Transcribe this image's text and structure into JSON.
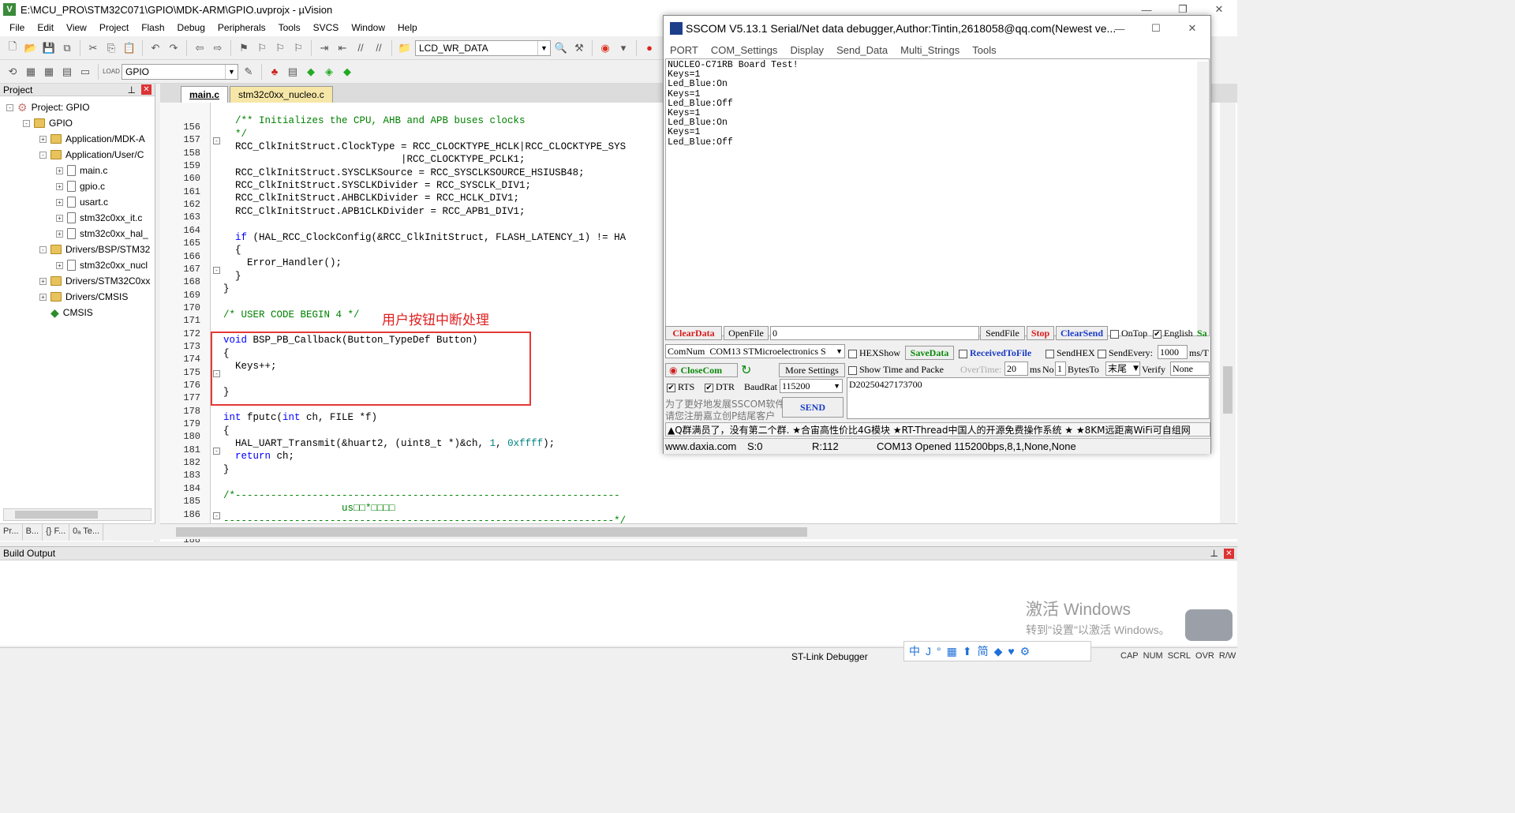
{
  "window": {
    "title": "E:\\MCU_PRO\\STM32C071\\GPIO\\MDK-ARM\\GPIO.uvprojx - µVision",
    "app_icon": "V"
  },
  "menu": [
    "File",
    "Edit",
    "View",
    "Project",
    "Flash",
    "Debug",
    "Peripherals",
    "Tools",
    "SVCS",
    "Window",
    "Help"
  ],
  "toolbar": {
    "combo1": "LCD_WR_DATA",
    "target": "GPIO"
  },
  "project": {
    "header": "Project",
    "tree": [
      {
        "label": "Project: GPIO",
        "level": 0,
        "type": "gear",
        "box": "-"
      },
      {
        "label": "GPIO",
        "level": 1,
        "type": "folder",
        "box": "-"
      },
      {
        "label": "Application/MDK-A",
        "level": 2,
        "type": "folder",
        "box": "+"
      },
      {
        "label": "Application/User/C",
        "level": 2,
        "type": "folder",
        "box": "-"
      },
      {
        "label": "main.c",
        "level": 3,
        "type": "file",
        "box": "+"
      },
      {
        "label": "gpio.c",
        "level": 3,
        "type": "file",
        "box": "+"
      },
      {
        "label": "usart.c",
        "level": 3,
        "type": "file",
        "box": "+"
      },
      {
        "label": "stm32c0xx_it.c",
        "level": 3,
        "type": "file",
        "box": "+"
      },
      {
        "label": "stm32c0xx_hal_",
        "level": 3,
        "type": "file",
        "box": "+"
      },
      {
        "label": "Drivers/BSP/STM32",
        "level": 2,
        "type": "folder",
        "box": "-"
      },
      {
        "label": "stm32c0xx_nucl",
        "level": 3,
        "type": "file",
        "box": "+"
      },
      {
        "label": "Drivers/STM32C0xx",
        "level": 2,
        "type": "folder",
        "box": "+"
      },
      {
        "label": "Drivers/CMSIS",
        "level": 2,
        "type": "folder",
        "box": "+"
      },
      {
        "label": "CMSIS",
        "level": 2,
        "type": "diamond",
        "box": ""
      }
    ],
    "tabs": [
      "Pr...",
      "B...",
      "{} F...",
      "0ₐ Te..."
    ]
  },
  "editor": {
    "tabs": [
      "main.c",
      "stm32c0xx_nucleo.c"
    ],
    "annotation": "用户按钮中断处理",
    "lines": [
      {
        "n": "156",
        "t": ""
      },
      {
        "n": "157",
        "t": "  /** Initializes the CPU, AHB and APB buses clocks",
        "c": "cm",
        "fold": "-"
      },
      {
        "n": "158",
        "t": "  */",
        "c": "cm"
      },
      {
        "n": "159",
        "t": "  RCC_ClkInitStruct.ClockType = RCC_CLOCKTYPE_HCLK|RCC_CLOCKTYPE_SYS"
      },
      {
        "n": "160",
        "t": "                              |RCC_CLOCKTYPE_PCLK1;"
      },
      {
        "n": "161",
        "t": "  RCC_ClkInitStruct.SYSCLKSource = RCC_SYSCLKSOURCE_HSIUSB48;"
      },
      {
        "n": "162",
        "t": "  RCC_ClkInitStruct.SYSCLKDivider = RCC_SYSCLK_DIV1;"
      },
      {
        "n": "163",
        "t": "  RCC_ClkInitStruct.AHBCLKDivider = RCC_HCLK_DIV1;"
      },
      {
        "n": "164",
        "t": "  RCC_ClkInitStruct.APB1CLKDivider = RCC_APB1_DIV1;"
      },
      {
        "n": "165",
        "t": ""
      },
      {
        "n": "166",
        "t": "  if (HAL_RCC_ClockConfig(&RCC_ClkInitStruct, FLASH_LATENCY_1) != HA"
      },
      {
        "n": "167",
        "t": "  {",
        "fold": "-"
      },
      {
        "n": "168",
        "t": "    Error_Handler();"
      },
      {
        "n": "169",
        "t": "  }"
      },
      {
        "n": "170",
        "t": "}"
      },
      {
        "n": "171",
        "t": ""
      },
      {
        "n": "172",
        "t": "/* USER CODE BEGIN 4 */",
        "c": "cm"
      },
      {
        "n": "173",
        "t": ""
      },
      {
        "n": "174",
        "t": "void BSP_PB_Callback(Button_TypeDef Button)"
      },
      {
        "n": "175",
        "t": "{",
        "fold": "-"
      },
      {
        "n": "176",
        "t": "  Keys++;"
      },
      {
        "n": "177",
        "t": ""
      },
      {
        "n": "178",
        "t": "}"
      },
      {
        "n": "179",
        "t": ""
      },
      {
        "n": "180",
        "t": "int fputc(int ch, FILE *f)"
      },
      {
        "n": "181",
        "t": "{",
        "fold": "-"
      },
      {
        "n": "182",
        "t": "  HAL_UART_Transmit(&huart2, (uint8_t *)&ch, 1, 0xffff);"
      },
      {
        "n": "183",
        "t": "  return ch;"
      },
      {
        "n": "184",
        "t": "}"
      },
      {
        "n": "185",
        "t": ""
      },
      {
        "n": "186",
        "t": "/*-----------------------------------------------------------------",
        "c": "cm",
        "fold": "-"
      },
      {
        "n": "187",
        "t": "                    us□□*□□□□",
        "c": "cm"
      },
      {
        "n": "188",
        "t": "------------------------------------------------------------------*/",
        "c": "cm"
      }
    ]
  },
  "build": {
    "header": "Build Output"
  },
  "status": {
    "debugger": "ST-Link Debugger",
    "flags": [
      "CAP",
      "NUM",
      "SCRL",
      "OVR",
      "R/W"
    ]
  },
  "watermark": {
    "line1": "激活 Windows",
    "line2": "转到\"设置\"以激活 Windows。"
  },
  "ime": [
    "中",
    "J",
    "°",
    "▦",
    "⬆",
    "简",
    "◆",
    "♥",
    "⚙"
  ],
  "sscom": {
    "title": "SSCOM V5.13.1 Serial/Net data debugger,Author:Tintin,2618058@qq.com(Newest ve...",
    "menu": [
      "PORT",
      "COM_Settings",
      "Display",
      "Send_Data",
      "Multi_Strings",
      "Tools"
    ],
    "received": [
      "NUCLEO-C71RB Board Test!",
      "Keys=1",
      "Led_Blue:On",
      "Keys=1",
      "Led_Blue:Off",
      "Keys=1",
      "Led_Blue:On",
      "Keys=1",
      "Led_Blue:Off"
    ],
    "row1": {
      "clear": "ClearData",
      "open": "OpenFile",
      "path": "0",
      "sendfile": "SendFile",
      "stop": "Stop",
      "clearsend": "ClearSend",
      "ontop": "OnTop",
      "english": "English",
      "save": "Sa"
    },
    "comnum_label": "ComNum",
    "comnum": "COM13 STMicroelectronics S",
    "hexshow": "HEXShow",
    "savedata": "SaveData",
    "recvtofile": "ReceivedToFile",
    "sendhex": "SendHEX",
    "sendevery": "SendEvery:",
    "sendevery_val": "1000",
    "unit": "ms/T",
    "closecom": "CloseCom",
    "more": "More Settings",
    "showtime": "Show Time and Packe",
    "overtime": "OverTime:",
    "ot_val": "20",
    "ms": "ms",
    "no": "No",
    "no_val": "1",
    "bytesto": "BytesTo",
    "bt_val": "末尾",
    "verify": "Verify",
    "verify_val": "None",
    "rts": "RTS",
    "dtr": "DTR",
    "baud_label": "BaudRat",
    "baud": "115200",
    "send_text": "D20250427173700",
    "promo1": "为了更好地发展SSCOM软件",
    "promo2": "请您注册嘉立创P结尾客户",
    "send": "SEND",
    "ticker": "▲Q群满员了，没有第二个群. ★合宙高性价比4G模块 ★RT-Thread中国人的开源免费操作系统 ★ ★8KM远距离WiFi可自组网",
    "status": {
      "site": "www.daxia.com",
      "s": "S:0",
      "r": "R:112",
      "port": "COM13 Opened  115200bps,8,1,None,None"
    }
  }
}
